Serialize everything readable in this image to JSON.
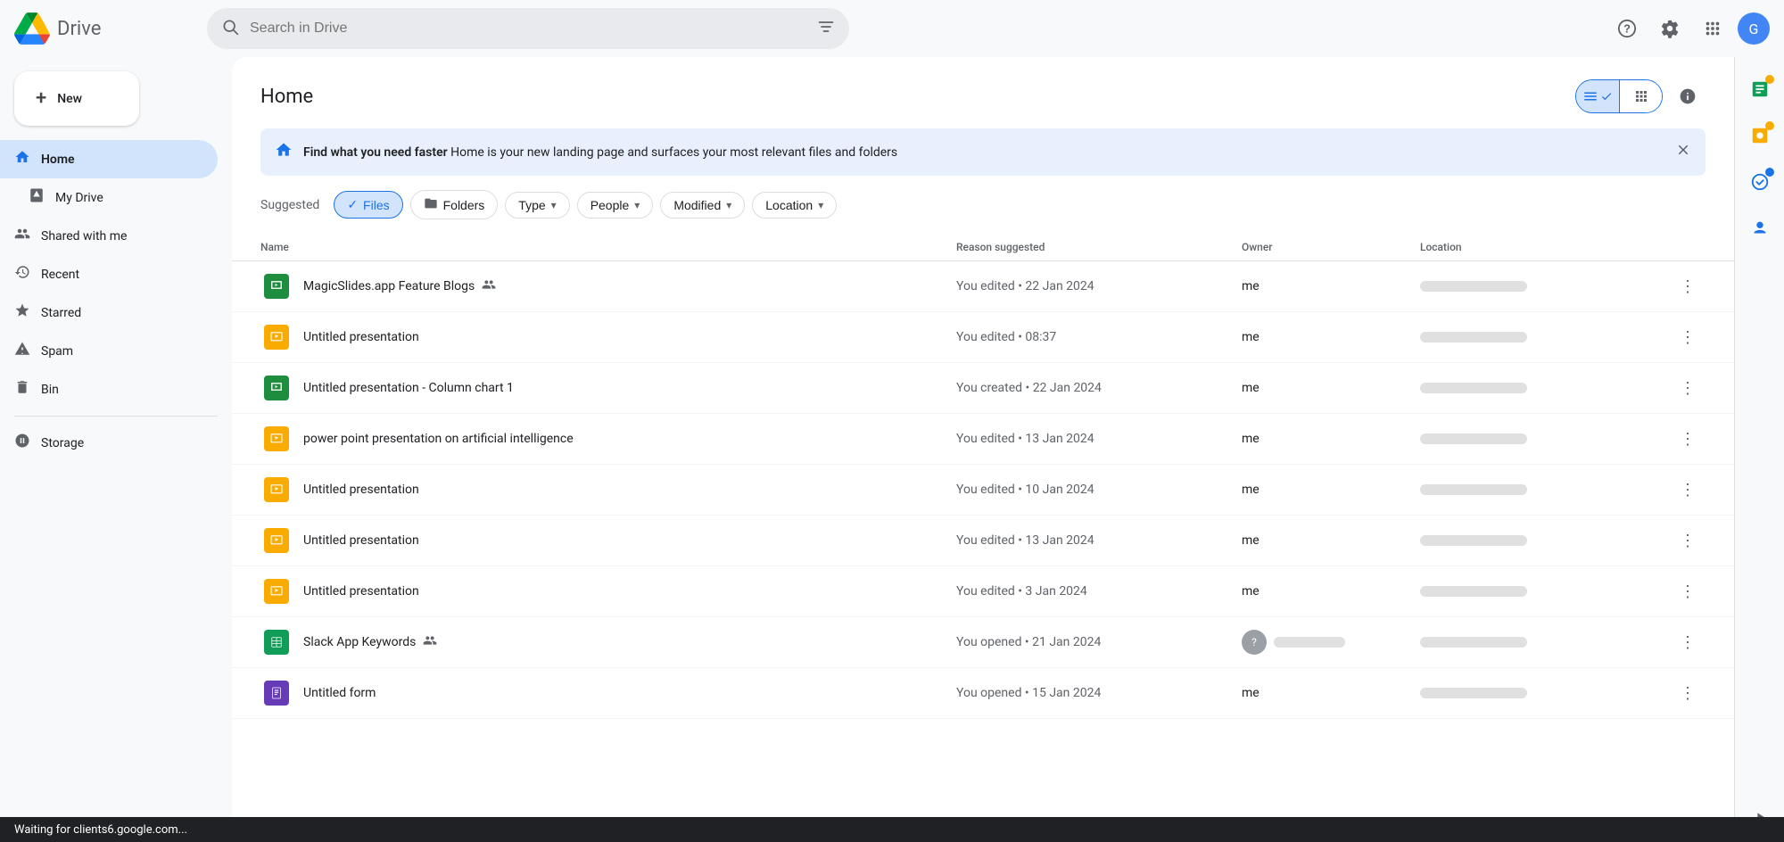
{
  "app": {
    "title": "Drive",
    "logo_alt": "Google Drive"
  },
  "header": {
    "search_placeholder": "Search in Drive",
    "page_title": "Home"
  },
  "sidebar": {
    "new_button": "New",
    "items": [
      {
        "id": "home",
        "label": "Home",
        "icon": "🏠",
        "active": true
      },
      {
        "id": "my-drive",
        "label": "My Drive",
        "icon": "📁",
        "active": false,
        "indent": true
      },
      {
        "id": "shared-with-me",
        "label": "Shared with me",
        "icon": "👥",
        "active": false
      },
      {
        "id": "recent",
        "label": "Recent",
        "icon": "🕐",
        "active": false
      },
      {
        "id": "starred",
        "label": "Starred",
        "icon": "⭐",
        "active": false
      },
      {
        "id": "spam",
        "label": "Spam",
        "icon": "⚠️",
        "active": false
      },
      {
        "id": "bin",
        "label": "Bin",
        "icon": "🗑️",
        "active": false
      },
      {
        "id": "storage",
        "label": "Storage",
        "icon": "☁️",
        "active": false
      }
    ]
  },
  "banner": {
    "text_bold": "Find what you need faster",
    "text_rest": " Home is your new landing page and surfaces your most relevant files and folders"
  },
  "filters": {
    "suggested_label": "Suggested",
    "chips": [
      {
        "id": "files",
        "label": "Files",
        "active": true,
        "has_check": true,
        "has_folder_icon": false
      },
      {
        "id": "folders",
        "label": "Folders",
        "active": false,
        "has_check": false,
        "has_folder_icon": true
      },
      {
        "id": "type",
        "label": "Type",
        "active": false,
        "has_arrow": true
      },
      {
        "id": "people",
        "label": "People",
        "active": false,
        "has_arrow": true
      },
      {
        "id": "modified",
        "label": "Modified",
        "active": false,
        "has_arrow": true
      },
      {
        "id": "location",
        "label": "Location",
        "active": false,
        "has_arrow": true
      }
    ]
  },
  "table": {
    "headers": {
      "name": "Name",
      "reason": "Reason suggested",
      "owner": "Owner",
      "location": "Location"
    },
    "rows": [
      {
        "id": "row1",
        "icon_type": "slides-green",
        "name": "MagicSlides.app Feature Blogs",
        "shared": true,
        "reason": "You edited • 22 Jan 2024",
        "owner": "me",
        "owner_pill": false,
        "location_pill": true
      },
      {
        "id": "row2",
        "icon_type": "slides-yellow",
        "name": "Untitled presentation",
        "shared": false,
        "reason": "You edited • 08:37",
        "owner": "me",
        "owner_pill": false,
        "location_pill": true
      },
      {
        "id": "row3",
        "icon_type": "slides-green",
        "name": "Untitled presentation - Column chart 1",
        "shared": false,
        "reason": "You created • 22 Jan 2024",
        "owner": "me",
        "owner_pill": false,
        "location_pill": true
      },
      {
        "id": "row4",
        "icon_type": "slides-yellow",
        "name": "power point presentation on artificial intelligence",
        "shared": false,
        "reason": "You edited • 13 Jan 2024",
        "owner": "me",
        "owner_pill": false,
        "location_pill": true
      },
      {
        "id": "row5",
        "icon_type": "slides-yellow",
        "name": "Untitled presentation",
        "shared": false,
        "reason": "You edited • 10 Jan 2024",
        "owner": "me",
        "owner_pill": false,
        "location_pill": true
      },
      {
        "id": "row6",
        "icon_type": "slides-yellow",
        "name": "Untitled presentation",
        "shared": false,
        "reason": "You edited • 13 Jan 2024",
        "owner": "me",
        "owner_pill": false,
        "location_pill": true
      },
      {
        "id": "row7",
        "icon_type": "slides-yellow",
        "name": "Untitled presentation",
        "shared": false,
        "reason": "You edited • 3 Jan 2024",
        "owner": "me",
        "owner_pill": false,
        "location_pill": true
      },
      {
        "id": "row8",
        "icon_type": "sheets-green",
        "name": "Slack App Keywords",
        "shared": true,
        "reason": "You opened • 21 Jan 2024",
        "owner": "",
        "owner_pill": true,
        "owner_avatar": true,
        "location_pill": true
      },
      {
        "id": "row9",
        "icon_type": "forms-purple",
        "name": "Untitled form",
        "shared": false,
        "reason": "You opened • 15 Jan 2024",
        "owner": "me",
        "owner_pill": false,
        "location_pill": true
      }
    ]
  },
  "status_bar": {
    "text": "Waiting for clients6.google.com..."
  },
  "right_panel": {
    "icons": [
      {
        "id": "sheets-side",
        "badge": "yellow"
      },
      {
        "id": "keep-side",
        "badge": "yellow"
      },
      {
        "id": "tasks-side",
        "badge": "blue"
      },
      {
        "id": "contacts-side",
        "badge": "none"
      }
    ]
  }
}
